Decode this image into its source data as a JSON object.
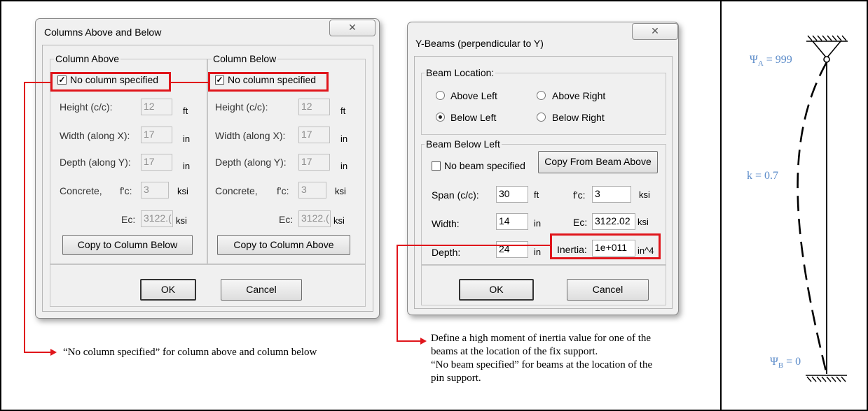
{
  "columns_dialog": {
    "title": "Columns Above and Below",
    "close_glyph": "✕",
    "column_above": {
      "group_label": "Column Above",
      "checkbox_label": "No column specified",
      "checked": true,
      "height_label": "Height (c/c):",
      "height_value": "12",
      "height_unit": "ft",
      "width_label": "Width (along X):",
      "width_value": "17",
      "width_unit": "in",
      "depth_label": "Depth (along Y):",
      "depth_value": "17",
      "depth_unit": "in",
      "concrete_label": "Concrete,",
      "fc_label": "f'c:",
      "fc_value": "3",
      "fc_unit": "ksi",
      "ec_label": "Ec:",
      "ec_value": "3122.(",
      "ec_unit": "ksi",
      "copy_button": "Copy to Column Below"
    },
    "column_below": {
      "group_label": "Column Below",
      "checkbox_label": "No column specified",
      "checked": true,
      "height_label": "Height (c/c):",
      "height_value": "12",
      "height_unit": "ft",
      "width_label": "Width (along X):",
      "width_value": "17",
      "width_unit": "in",
      "depth_label": "Depth (along Y):",
      "depth_value": "17",
      "depth_unit": "in",
      "concrete_label": "Concrete,",
      "fc_label": "f'c:",
      "fc_value": "3",
      "fc_unit": "ksi",
      "ec_label": "Ec:",
      "ec_value": "3122.(",
      "ec_unit": "ksi",
      "copy_button": "Copy to Column Above"
    },
    "ok_button": "OK",
    "cancel_button": "Cancel"
  },
  "beams_dialog": {
    "title": "Y-Beams (perpendicular to Y)",
    "close_glyph": "✕",
    "location": {
      "group_label": "Beam Location:",
      "options": [
        "Above Left",
        "Above Right",
        "Below Left",
        "Below Right"
      ],
      "selected": "Below Left"
    },
    "beam": {
      "group_label": "Beam Below Left",
      "checkbox_label": "No beam specified",
      "checked": false,
      "copy_button": "Copy From Beam Above",
      "span_label": "Span (c/c):",
      "span_value": "30",
      "span_unit": "ft",
      "fc_label": "f'c:",
      "fc_value": "3",
      "fc_unit": "ksi",
      "width_label": "Width:",
      "width_value": "14",
      "width_unit": "in",
      "ec_label": "Ec:",
      "ec_value": "3122.02",
      "ec_unit": "ksi",
      "depth_label": "Depth:",
      "depth_value": "24",
      "depth_unit": "in",
      "inertia_label": "Inertia:",
      "inertia_value": "1e+011",
      "inertia_unit": "in^4"
    },
    "ok_button": "OK",
    "cancel_button": "Cancel"
  },
  "notes": {
    "columns_note": "“No column specified” for column above and column below",
    "beams_note": [
      "Define a high moment of inertia value for one of the",
      "beams at the location of the fix support.",
      "“No beam specified” for beams at the location of the",
      "pin support."
    ]
  },
  "sketch": {
    "psi_a_symbol": "Ψ",
    "psi_a_sub": "A",
    "psi_a_value": " = 999",
    "k_label": "k = 0.7",
    "psi_b_symbol": "Ψ",
    "psi_b_sub": "B",
    "psi_b_value": " = 0",
    "label_color": "#5b8bc9"
  },
  "colors": {
    "highlight": "#e0151b",
    "dialog_bg": "#f0f0f0"
  }
}
